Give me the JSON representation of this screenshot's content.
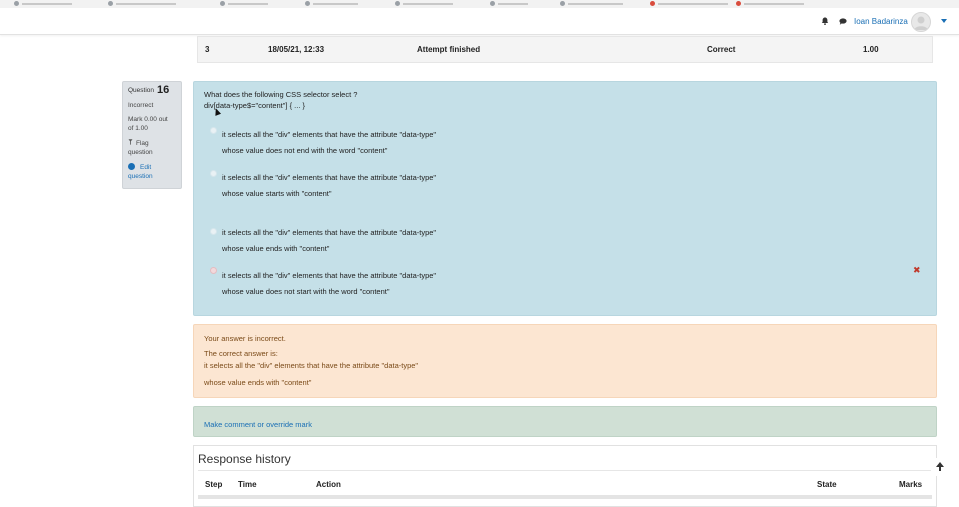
{
  "header": {
    "user_name": "Ioan Badarinza"
  },
  "previous_attempt_row": {
    "step": "3",
    "time": "18/05/21, 12:33",
    "action": "Attempt finished",
    "state": "Correct",
    "marks": "1.00"
  },
  "question_info": {
    "label": "Question",
    "number": "16",
    "status": "Incorrect",
    "mark_line1": "Mark 0.00 out",
    "mark_line2": "of 1.00",
    "flag_line1": "Flag",
    "flag_line2": "question",
    "edit_line1": "Edit",
    "edit_line2": "question"
  },
  "question": {
    "prompt": "What does the following CSS selector select ?",
    "code": "div[data-type$=\"content\"] { ... }",
    "options": [
      {
        "line1": "it selects all the \"div\" elements that have the attribute \"data-type\"",
        "line2": "whose value does not end with the word \"content\""
      },
      {
        "line1": "it selects all the \"div\" elements that have the attribute \"data-type\"",
        "line2": "whose value starts with \"content\""
      },
      {
        "line1": "it selects all the \"div\" elements that have the attribute \"data-type\"",
        "line2": "whose value ends with \"content\""
      },
      {
        "line1": "it selects all the \"div\" elements that have the attribute \"data-type\"",
        "line2": "whose value does not start with the word \"content\""
      }
    ],
    "incorrect_mark": "✖"
  },
  "feedback": {
    "result": "Your answer is incorrect.",
    "correct_label": "The correct answer is:",
    "correct_line1": "it selects all the \"div\" elements that have the attribute \"data-type\"",
    "correct_line2": "whose value ends with \"content\""
  },
  "comment": {
    "link": "Make comment or override mark"
  },
  "history": {
    "title": "Response history",
    "columns": [
      "Step",
      "Time",
      "Action",
      "State",
      "Marks"
    ]
  },
  "colors": {
    "question_bg": "#c5e0e8",
    "feedback_bg": "#fce6d2",
    "comment_bg": "#d0e0d5",
    "link": "#1a6fb5",
    "incorrect": "#c0392b"
  }
}
